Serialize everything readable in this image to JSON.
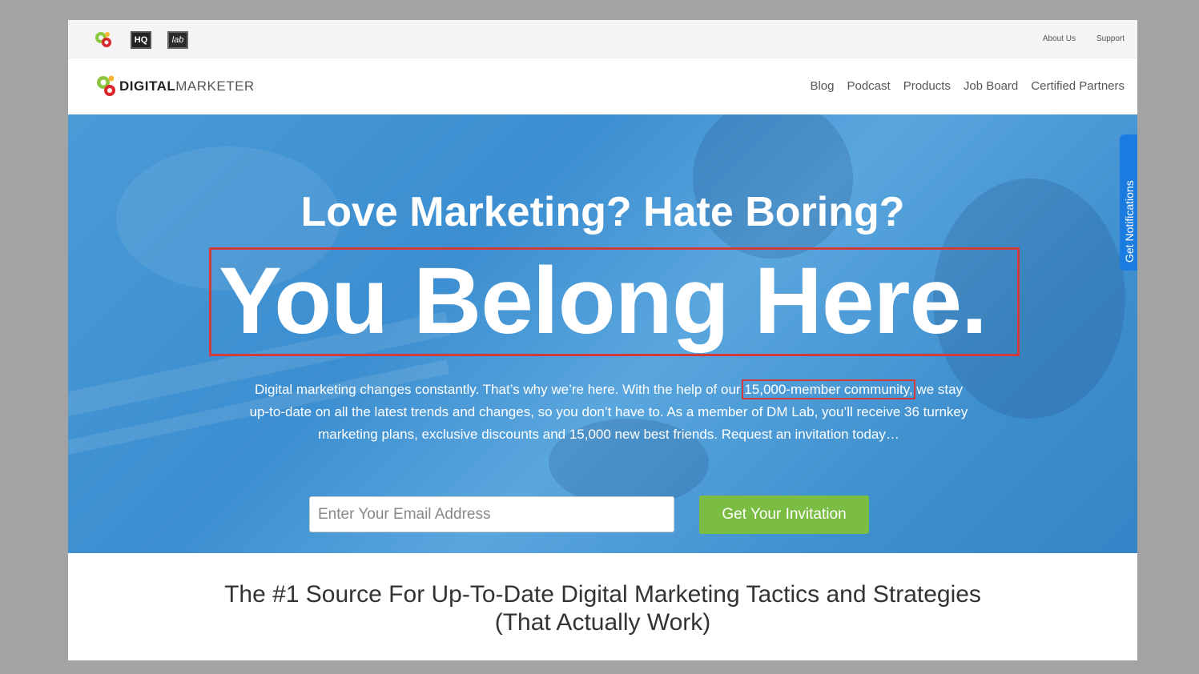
{
  "topbar": {
    "brand_icons": [
      "gear-logo-icon",
      "hq-icon",
      "lab-icon"
    ],
    "hq_label": "HQ",
    "lab_label": "lab",
    "links": [
      "About Us",
      "Support"
    ]
  },
  "nav": {
    "logo_bold": "DIGITAL",
    "logo_light": "MARKETER",
    "links": [
      "Blog",
      "Podcast",
      "Products",
      "Job Board",
      "Certified Partners"
    ]
  },
  "hero": {
    "subtitle": "Love Marketing? Hate Boring?",
    "headline": "You Belong Here.",
    "desc_before": "Digital marketing changes constantly. That’s why we’re here. With the help of our ",
    "desc_highlight": "15,000-member community,",
    "desc_after": " we stay up-to-date on all the latest trends and changes, so you don’t have to. As a member of DM Lab, you’ll receive 36 turnkey marketing plans, exclusive discounts and 15,000 new best friends. Request an invitation today…",
    "email_placeholder": "Enter Your Email Address",
    "cta_label": "Get Your Invitation"
  },
  "notification_tab": "Get Notifications",
  "tagline": {
    "line1": "The #1 Source For Up-To-Date Digital Marketing Tactics and Strategies",
    "line2": "(That Actually Work)"
  },
  "colors": {
    "hero_blue": "#3b8ed0",
    "cta_green": "#7bbd43",
    "highlight_red": "#d33b3b",
    "notif_blue": "#1a7be0"
  }
}
